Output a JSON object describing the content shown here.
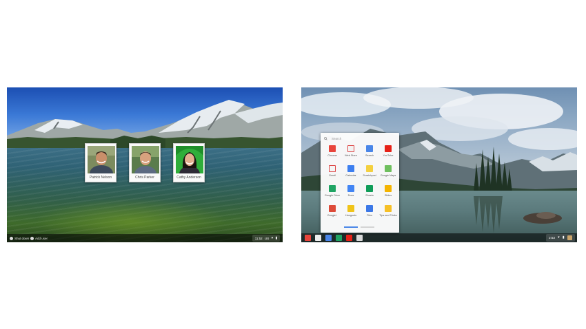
{
  "login_screen": {
    "users": [
      {
        "name": "Patrick Nelson"
      },
      {
        "name": "Chris Parker"
      },
      {
        "name": "Cathy Anderson"
      }
    ],
    "shelf": {
      "shutdown_label": "Shut down",
      "add_user_label": "Add user"
    },
    "tray": {
      "time": "11:52",
      "locale": "US"
    }
  },
  "desktop": {
    "launcher": {
      "search_placeholder": "Search",
      "apps": [
        {
          "label": "Chrome",
          "icon": "chrome-icon",
          "color": "#e8453c"
        },
        {
          "label": "Web Store",
          "icon": "web-store-icon",
          "color": "#f2f2f2"
        },
        {
          "label": "Search",
          "icon": "google-search-icon",
          "color": "#4a86e8"
        },
        {
          "label": "YouTube",
          "icon": "youtube-icon",
          "color": "#e62117"
        },
        {
          "label": "Gmail",
          "icon": "gmail-icon",
          "color": "#f5f5f5"
        },
        {
          "label": "Calendar",
          "icon": "calendar-icon",
          "color": "#3d7ff0"
        },
        {
          "label": "Scratchpad",
          "icon": "scratchpad-icon",
          "color": "#f4d03f"
        },
        {
          "label": "Google Maps",
          "icon": "maps-icon",
          "color": "#6fbf5e"
        },
        {
          "label": "Google Drive",
          "icon": "drive-icon",
          "color": "#1fa463"
        },
        {
          "label": "Docs",
          "icon": "docs-icon",
          "color": "#4285f4"
        },
        {
          "label": "Sheets",
          "icon": "sheets-icon",
          "color": "#0f9d58"
        },
        {
          "label": "Slides",
          "icon": "slides-icon",
          "color": "#f4b400"
        },
        {
          "label": "Google+",
          "icon": "google-plus-icon",
          "color": "#dd4b39"
        },
        {
          "label": "Hangouts",
          "icon": "hangouts-icon",
          "color": "#f0c419"
        },
        {
          "label": "Files",
          "icon": "files-icon",
          "color": "#3b78e7"
        },
        {
          "label": "Tips and Tricks",
          "icon": "tips-icon",
          "color": "#f6c026"
        }
      ]
    },
    "shelf_apps": [
      {
        "icon": "chrome-icon",
        "color": "#e8453c"
      },
      {
        "icon": "gmail-icon",
        "color": "#eeeeee"
      },
      {
        "icon": "google-search-icon",
        "color": "#4a86e8"
      },
      {
        "icon": "drive-icon",
        "color": "#1fa463"
      },
      {
        "icon": "youtube-icon",
        "color": "#e62117"
      },
      {
        "icon": "launcher-icon",
        "color": "#d9d9d9"
      }
    ],
    "tray": {
      "time": "2:53"
    }
  }
}
